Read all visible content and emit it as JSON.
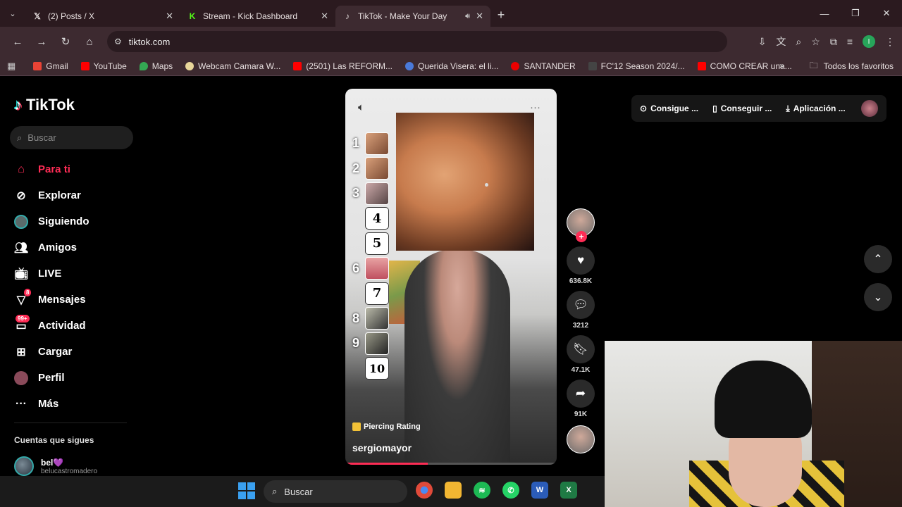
{
  "browser": {
    "tabs": [
      {
        "icon": "x-logo-icon",
        "title": "(2) Posts / X"
      },
      {
        "icon": "kick-logo-icon",
        "title": "Stream - Kick Dashboard"
      },
      {
        "icon": "tiktok-logo-icon",
        "title": "TikTok - Make Your Day",
        "active": true
      }
    ],
    "url": "tiktok.com",
    "bookmarks": [
      {
        "label": "Gmail",
        "color": "#ea4335"
      },
      {
        "label": "YouTube",
        "color": "#ff0000"
      },
      {
        "label": "Maps",
        "color": "#34a853"
      },
      {
        "label": "Webcam Camara W...",
        "color": "#e8d69a"
      },
      {
        "label": "(2501) Las REFORM...",
        "color": "#ff0000"
      },
      {
        "label": "Querida Visera: el li...",
        "color": "#4a7ad9"
      },
      {
        "label": "SANTANDER",
        "color": "#ec0000"
      },
      {
        "label": "FC'12 Season 2024/...",
        "color": "#444444"
      },
      {
        "label": "COMO CREAR una...",
        "color": "#ff0000"
      }
    ],
    "all_bookmarks": "Todos los favoritos",
    "profile_initial": "I"
  },
  "tiktok": {
    "brand": "TikTok",
    "search_placeholder": "Buscar",
    "nav": [
      {
        "label": "Para ti",
        "icon": "home-icon",
        "active": true
      },
      {
        "label": "Explorar",
        "icon": "compass-icon"
      },
      {
        "label": "Siguiendo",
        "icon": "following-avatar-icon"
      },
      {
        "label": "Amigos",
        "icon": "friends-icon"
      },
      {
        "label": "LIVE",
        "icon": "live-icon"
      },
      {
        "label": "Mensajes",
        "icon": "messages-icon",
        "badge": "8"
      },
      {
        "label": "Actividad",
        "icon": "activity-icon",
        "badge": "99+"
      },
      {
        "label": "Cargar",
        "icon": "upload-icon"
      },
      {
        "label": "Perfil",
        "icon": "profile-avatar-icon"
      },
      {
        "label": "Más",
        "icon": "more-icon"
      }
    ],
    "following_title": "Cuentas que sigues",
    "following": [
      {
        "name": "bel💜",
        "handle": "belucastromadero"
      }
    ],
    "video": {
      "ranking": [
        "1",
        "2",
        "3",
        "4",
        "5",
        "6",
        "7",
        "8",
        "9",
        "10"
      ],
      "ranking_boxed": [
        "4",
        "5",
        "7",
        "10"
      ],
      "tag": "Piercing Rating",
      "author": "sergiomayor",
      "progress": 0.39
    },
    "actions": {
      "likes": "636.8K",
      "comments": "3212",
      "saves": "47.1K",
      "shares": "91K"
    },
    "top_right": {
      "coins": "Consigue ...",
      "app": "Conseguir ...",
      "download": "Aplicación ..."
    }
  },
  "taskbar": {
    "search_label": "Buscar",
    "apps": [
      {
        "name": "chrome",
        "color": "#e04a3a"
      },
      {
        "name": "files",
        "color": "#f2b632"
      },
      {
        "name": "spotify",
        "color": "#1db954"
      },
      {
        "name": "whatsapp",
        "color": "#25d366"
      },
      {
        "name": "word",
        "color": "#2b5cb8"
      },
      {
        "name": "excel",
        "color": "#1f7a44"
      }
    ]
  }
}
